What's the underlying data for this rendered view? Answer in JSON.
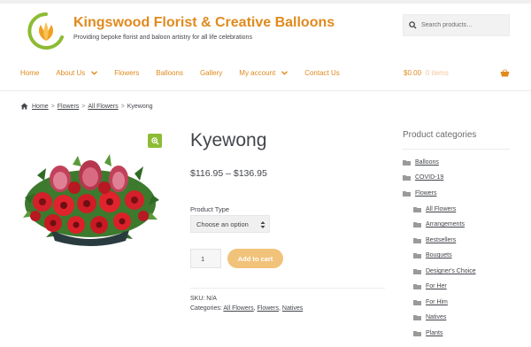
{
  "site": {
    "title": "Kingswood Florist & Creative Balloons",
    "tagline": "Providing bepoke florist and baloon artistry for all life celebrations"
  },
  "search": {
    "placeholder": "Search products…"
  },
  "nav": {
    "items": [
      {
        "label": "Home",
        "dropdown": false
      },
      {
        "label": "About Us",
        "dropdown": true
      },
      {
        "label": "Flowers",
        "dropdown": false
      },
      {
        "label": "Balloons",
        "dropdown": false
      },
      {
        "label": "Gallery",
        "dropdown": false
      },
      {
        "label": "My account",
        "dropdown": true
      },
      {
        "label": "Contact Us",
        "dropdown": false
      }
    ]
  },
  "cart": {
    "amount": "$0.00",
    "count": "0 items"
  },
  "breadcrumb": {
    "home": "Home",
    "flowers": "Flowers",
    "all_flowers": "All Flowers",
    "current": "Kyewong",
    "separator": ">"
  },
  "product": {
    "title": "Kyewong",
    "price": "$116.95 – $136.95",
    "variant_label": "Product Type",
    "variant_value": "Choose an option",
    "quantity": "1",
    "add_to_cart": "Add to cart",
    "sku_text": "SKU: N/A",
    "categories_prefix": "Categories:",
    "categories": [
      "All Flowers",
      "Flowers",
      "Natives"
    ],
    "category_separator": ", "
  },
  "sidebar": {
    "title": "Product categories",
    "categories": [
      {
        "label": "Balloons",
        "level": 0
      },
      {
        "label": "COVID-19",
        "level": 0
      },
      {
        "label": "Flowers",
        "level": 0
      },
      {
        "label": "All Flowers",
        "level": 1
      },
      {
        "label": "Arrangements",
        "level": 1
      },
      {
        "label": "Bestsellers",
        "level": 1
      },
      {
        "label": "Bouquets",
        "level": 1
      },
      {
        "label": "Designer's Choice",
        "level": 1
      },
      {
        "label": "For Her",
        "level": 1
      },
      {
        "label": "For Him",
        "level": 1
      },
      {
        "label": "Natives",
        "level": 1
      },
      {
        "label": "Plants",
        "level": 1
      }
    ]
  },
  "colors": {
    "accent": "#e08a1e",
    "button": "#f1c279",
    "zoom": "#8dbb34"
  },
  "icons": [
    "search-icon",
    "home-icon",
    "basket-icon",
    "zoom-icon",
    "chevron-down-icon",
    "folder-icon"
  ]
}
